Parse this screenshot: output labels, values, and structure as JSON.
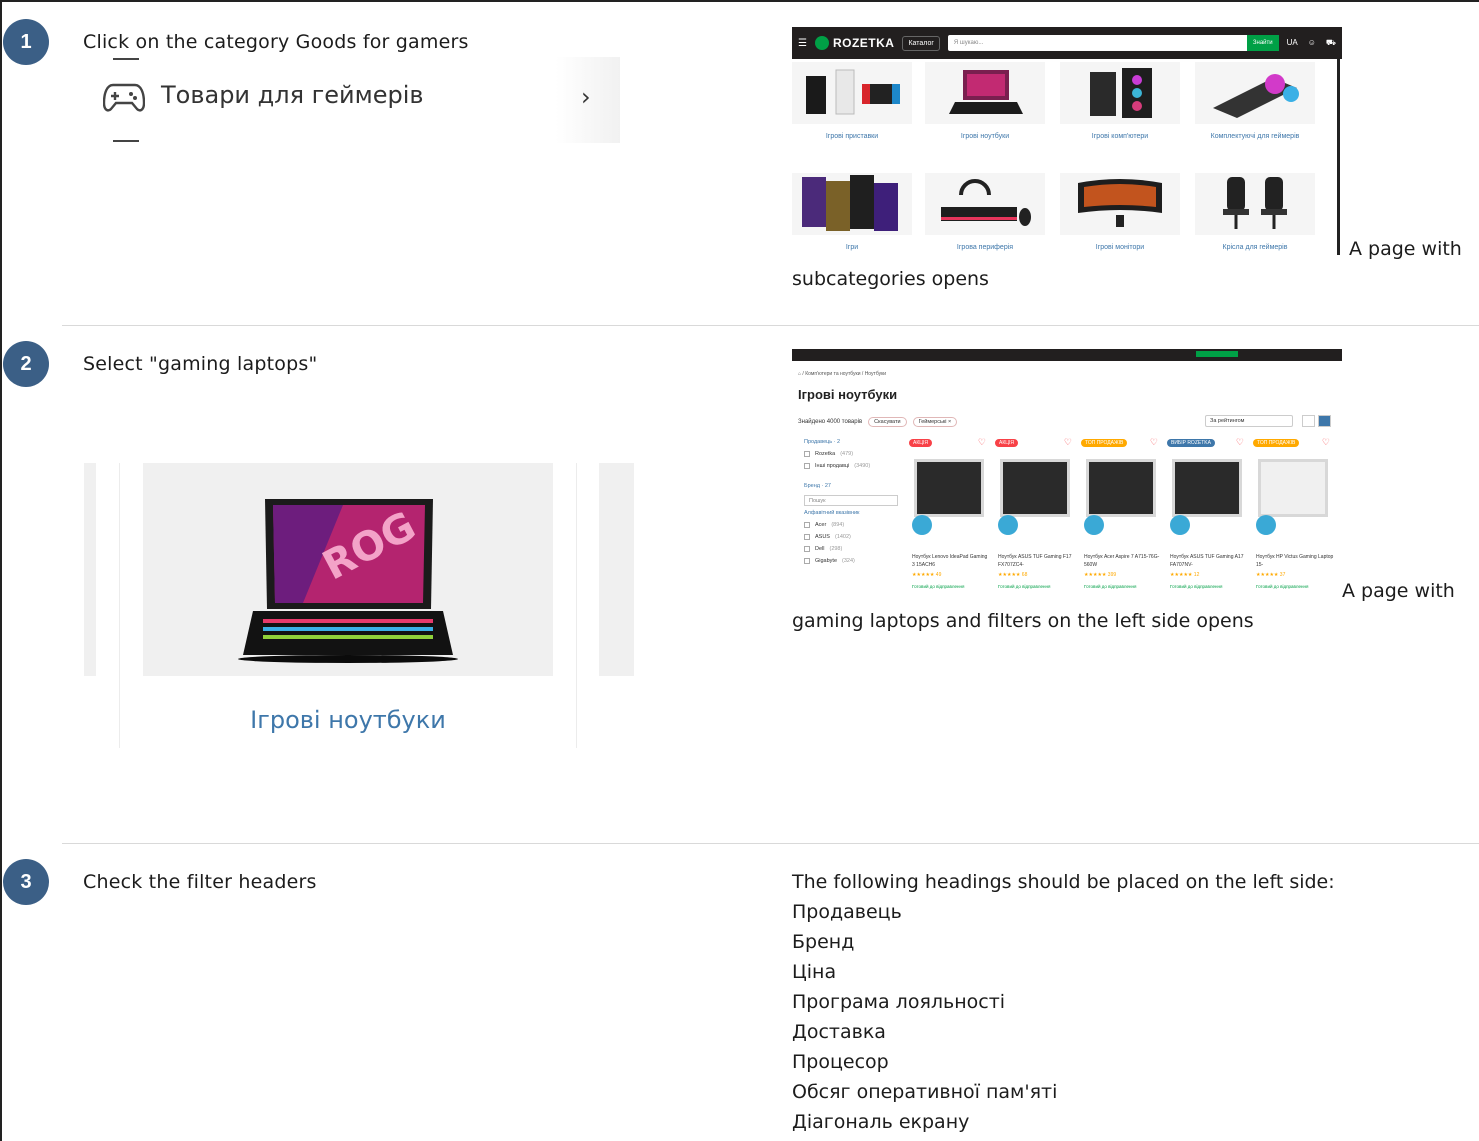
{
  "steps": [
    {
      "number": "1",
      "action": "Click on the category Goods for gamers",
      "result": "A page with subcategories opens"
    },
    {
      "number": "2",
      "action": "Select \"gaming laptops\"",
      "result": "A page with gaming laptops and filters on the left side opens"
    },
    {
      "number": "3",
      "action": "Check the filter headers",
      "result_intro": "The following headings should be placed on the left side:",
      "headings": [
        "Продавець",
        "Бренд",
        "Ціна",
        "Програма лояльності",
        "Доставка",
        "Процесор",
        "Обсяг оперативної пам'яті",
        "Діагональ екрану"
      ]
    }
  ],
  "step1_crop": {
    "category_label": "Товари для геймерів",
    "chevron": "›",
    "icon": "gamepad-icon"
  },
  "rozetka_header": {
    "logo": "ROZETKA",
    "catalog": "Каталог",
    "search_placeholder": "Я шукаю...",
    "search_button": "Знайти",
    "lang": "UA"
  },
  "subcategories": [
    "Ігрові приставки",
    "Ігрові ноутбуки",
    "Ігрові комп'ютери",
    "Комплектуючі для геймерів",
    "Ігри",
    "Ігрова периферія",
    "Ігрові монітори",
    "Крісла для геймерів"
  ],
  "step2_crop": {
    "card_label": "Ігрові ноутбуки"
  },
  "laptops_page": {
    "breadcrumb": "Комп'ютери та ноутбуки / Ноутбуки",
    "title": "Ігрові ноутбуки",
    "found": "Знайдено 4000 товарів",
    "reset_chip": "Скасувати",
    "filter_chip": "Геймерські ×",
    "sort": "За рейтингом",
    "filter_seller": "Продавець · 2",
    "sellers": [
      {
        "name": "Rozetka",
        "count": "(479)"
      },
      {
        "name": "Інші продавці",
        "count": "(3490)"
      }
    ],
    "filter_brand": "Бренд · 27",
    "search_label": "Пошук",
    "alphabet": "Алфавітний вказівник",
    "brands": [
      {
        "name": "Acer",
        "count": "(894)"
      },
      {
        "name": "ASUS",
        "count": "(1402)"
      },
      {
        "name": "Dell",
        "count": "(298)"
      },
      {
        "name": "Gigabyte",
        "count": "(324)"
      }
    ],
    "products": [
      {
        "tag": "АКЦІЯ",
        "tag_color": "#f84147",
        "name": "Ноутбук Lenovo IdeaPad Gaming 3 15ACH6",
        "rating": "★★★★★ 49"
      },
      {
        "tag": "АКЦІЯ",
        "tag_color": "#f84147",
        "name": "Ноутбук ASUS TUF Gaming F17 FX707ZC4-",
        "rating": "★★★★★ 68"
      },
      {
        "tag": "ТОП ПРОДАЖІВ",
        "tag_color": "#ffa900",
        "name": "Ноутбук Acer Aspire 7 A715-76G-560W",
        "rating": "★★★★★ 399"
      },
      {
        "tag": "ВИБІР ROZETKA",
        "tag_color": "#3e77aa",
        "name": "Ноутбук ASUS TUF Gaming A17 FA707NV-",
        "rating": "★★★★★ 12"
      },
      {
        "tag": "ТОП ПРОДАЖІВ",
        "tag_color": "#ffa900",
        "name": "Ноутбук HP Victus Gaming Laptop 15-",
        "rating": "★★★★★ 37"
      }
    ],
    "ready_text": "Готовий до відправлення"
  }
}
